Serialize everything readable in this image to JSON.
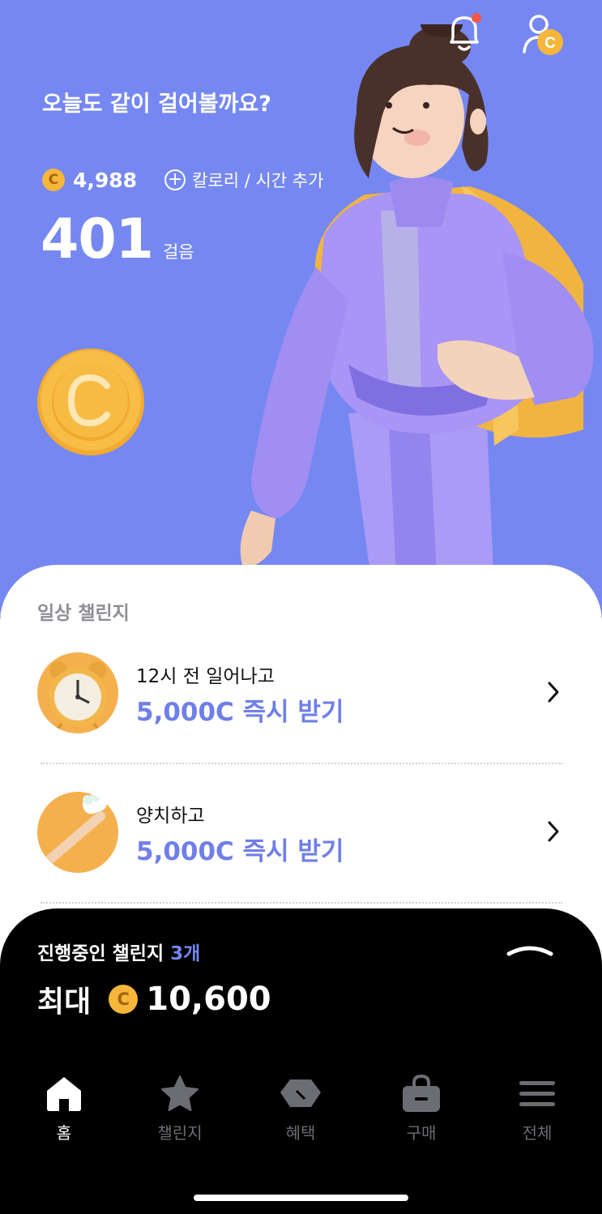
{
  "header": {
    "greeting": "오늘도 같이 걸어볼까요?",
    "coin_symbol": "C",
    "coin_balance": "4,988",
    "add_label": "칼로리 / 시간 추가",
    "steps": "401",
    "steps_unit": "걸음",
    "notification_badge": true
  },
  "daily": {
    "section_title": "일상 챌린지",
    "items": [
      {
        "title": "12시 전 일어나고",
        "reward": "5,000C 즉시 받기",
        "icon": "alarm-clock-icon"
      },
      {
        "title": "양치하고",
        "reward": "5,000C 즉시 받기",
        "icon": "toothbrush-icon"
      }
    ]
  },
  "sheet": {
    "label": "진행중인 챌린지",
    "count": "3개",
    "max_label": "최대",
    "coin_symbol": "C",
    "max_amount": "10,600"
  },
  "tabs": [
    {
      "label": "홈",
      "icon": "home-icon",
      "active": true
    },
    {
      "label": "챌린지",
      "icon": "star-icon",
      "active": false
    },
    {
      "label": "혜택",
      "icon": "tag-icon",
      "active": false
    },
    {
      "label": "구매",
      "icon": "shopping-bag-icon",
      "active": false
    },
    {
      "label": "전체",
      "icon": "menu-icon",
      "active": false
    }
  ],
  "colors": {
    "hero_bg": "#7587f1",
    "accent": "#6f7fe8",
    "coin": "#f6b63b",
    "badge": "#f0574a"
  }
}
